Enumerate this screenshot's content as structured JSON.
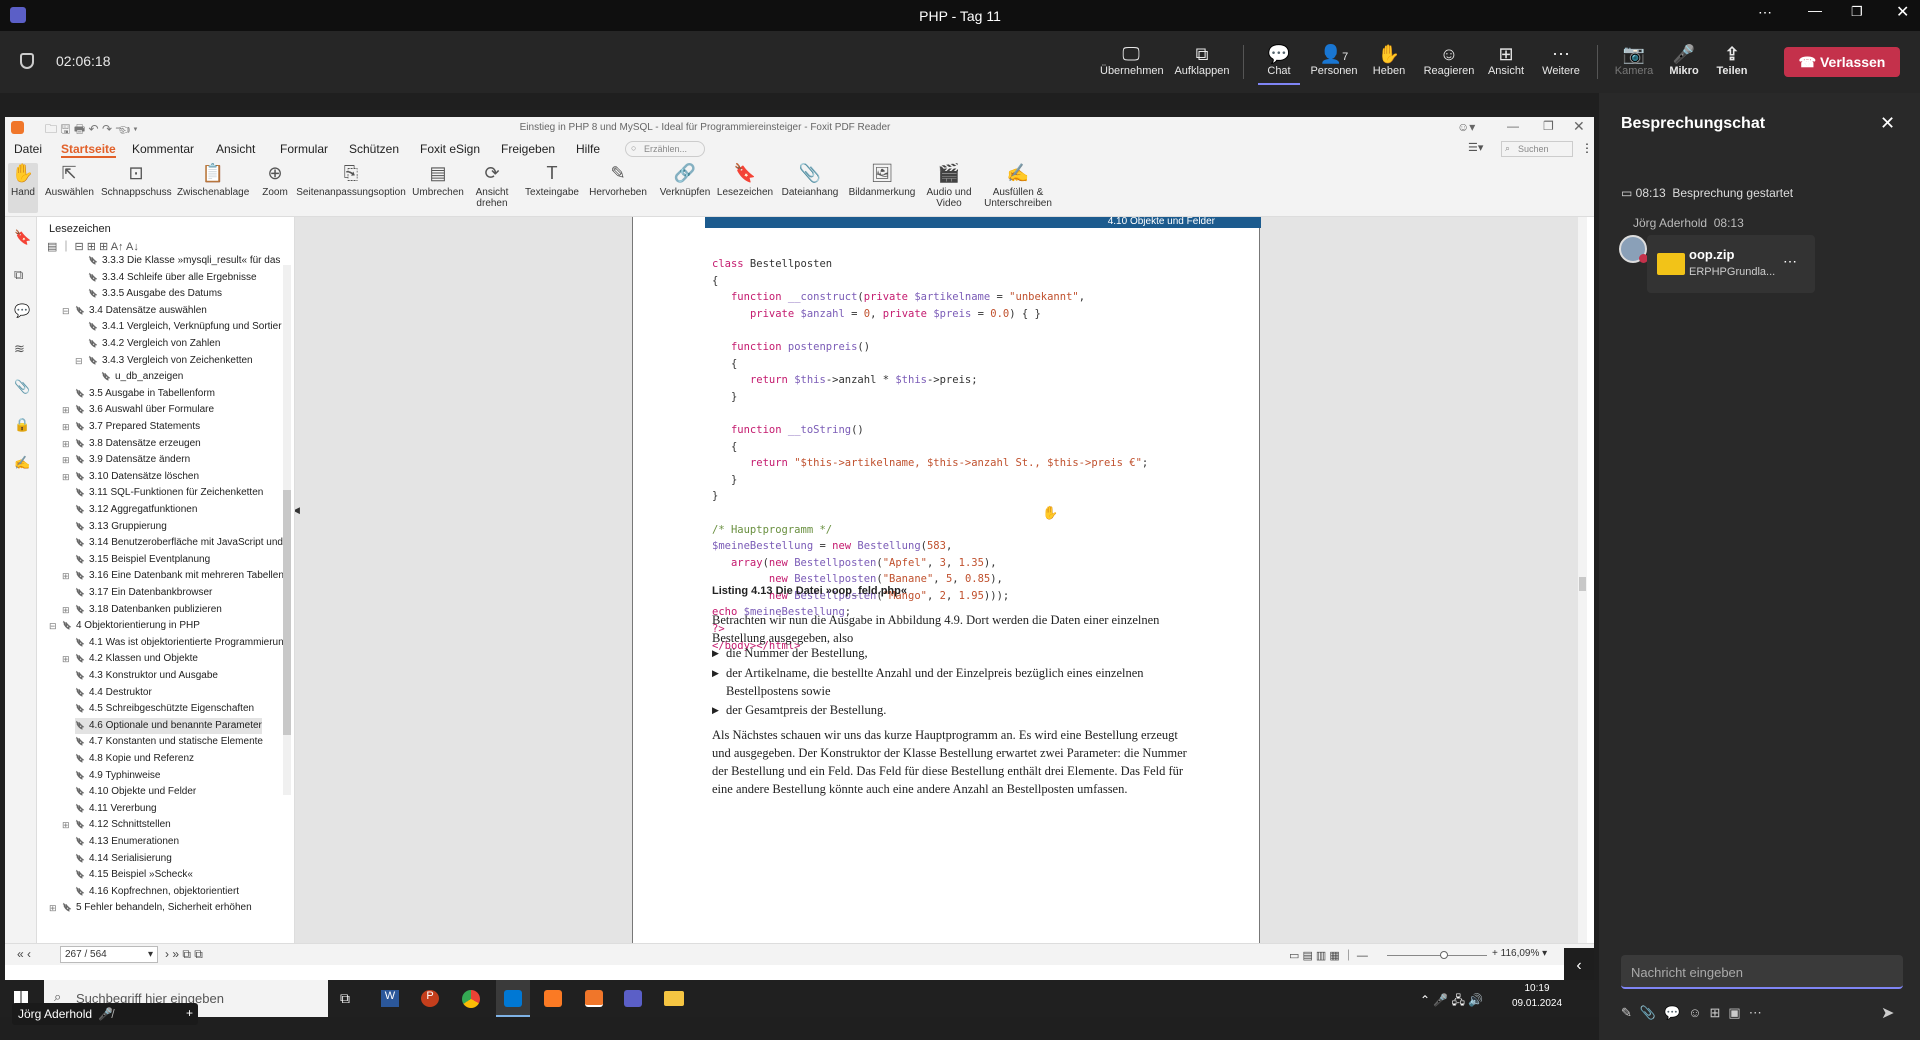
{
  "window_title": "PHP - Tag 11",
  "meeting": {
    "timer": "02:06:18",
    "buttons": [
      "Übernehmen",
      "Aufklappen",
      "Chat",
      "Personen",
      "Heben",
      "Reagieren",
      "Ansicht",
      "Weitere",
      "Kamera",
      "Mikro",
      "Teilen"
    ],
    "people_count": "7",
    "leave_label": "Verlassen"
  },
  "pdf": {
    "title": "Einstieg in PHP 8 und MySQL - Ideal für Programmiereinsteiger - Foxit PDF Reader",
    "menu": [
      "Datei",
      "Startseite",
      "Kommentar",
      "Ansicht",
      "Formular",
      "Schützen",
      "Foxit eSign",
      "Freigeben",
      "Hilfe"
    ],
    "tell_placeholder": "Erzählen...",
    "search_placeholder": "Suchen",
    "ribbon": [
      "Hand",
      "Auswählen",
      "Schnappschuss",
      "Zwischenablage",
      "Zoom",
      "Seitenanpassungsoption",
      "Umbrechen",
      "Ansicht drehen",
      "Texteingabe",
      "Hervorheben",
      "Verknüpfen",
      "Lesezeichen",
      "Dateianhang",
      "Bildanmerkung",
      "Audio und Video",
      "Ausfüllen & Unterschreiben"
    ],
    "bookmarks_title": "Lesezeichen",
    "bookmarks": [
      "3.3.3 Die Klasse »mysqli_result« für das E",
      "3.3.4 Schleife über alle Ergebnisse",
      "3.3.5 Ausgabe des Datums",
      "3.4 Datensätze auswählen",
      "3.4.1 Vergleich, Verknüpfung und Sortier",
      "3.4.2 Vergleich von Zahlen",
      "3.4.3 Vergleich von Zeichenketten",
      "u_db_anzeigen",
      "3.5 Ausgabe in Tabellenform",
      "3.6 Auswahl über Formulare",
      "3.7 Prepared Statements",
      "3.8 Datensätze erzeugen",
      "3.9 Datensätze ändern",
      "3.10 Datensätze löschen",
      "3.11 SQL-Funktionen für Zeichenketten",
      "3.12 Aggregatfunktionen",
      "3.13 Gruppierung",
      "3.14 Benutzeroberfläche mit JavaScript und",
      "3.15 Beispiel Eventplanung",
      "3.16 Eine Datenbank mit mehreren Tabellen",
      "3.17 Ein Datenbankbrowser",
      "3.18 Datenbanken publizieren",
      "4 Objektorientierung in PHP",
      "4.1 Was ist objektorientierte Programmierun",
      "4.2 Klassen und Objekte",
      "4.3 Konstruktor und Ausgabe",
      "4.4 Destruktor",
      "4.5 Schreibgeschützte Eigenschaften",
      "4.6 Optionale und benannte Parameter",
      "4.7 Konstanten und statische Elemente",
      "4.8 Kopie und Referenz",
      "4.9 Typhinweise",
      "4.10 Objekte und Felder",
      "4.11 Vererbung",
      "4.12 Schnittstellen",
      "4.13 Enumerationen",
      "4.14 Serialisierung",
      "4.15 Beispiel »Scheck«",
      "4.16 Kopfrechnen, objektorientiert",
      "5 Fehler behandeln, Sicherheit erhöhen"
    ],
    "header_band": "4.10   Objekte und Felder",
    "listing_caption": "Listing 4.13  Die Datei »oop_feld.php«",
    "para1": "Betrachten wir nun die Ausgabe in Abbildung 4.9. Dort werden die Daten einer einzelnen Bestellung ausgegeben, also",
    "bullets": [
      "die Nummer der Bestellung,",
      "der Artikelname, die bestellte Anzahl und der Einzelpreis bezüglich eines einzelnen Bestellpostens sowie",
      "der Gesamtpreis der Bestellung."
    ],
    "para2": "Als Nächstes schauen wir uns das kurze Hauptprogramm an. Es wird eine Bestellung erzeugt und ausgegeben. Der Konstruktor der Klasse Bestellung erwartet zwei Parameter: die Nummer der Bestellung und ein Feld. Das Feld für diese Bestellung enthält drei Elemente. Das Feld für eine andere Bestellung könnte auch eine andere Anzahl an Bestellposten umfassen.",
    "page_indicator": "267 / 564",
    "zoom": "116,09%"
  },
  "taskbar": {
    "search_placeholder": "Suchbegriff hier eingeben",
    "time": "10:19",
    "date": "09.01.2024",
    "presenter": "Jörg Aderhold"
  },
  "chat": {
    "title": "Besprechungschat",
    "meeting_time": "08:13",
    "meeting_event": "Besprechung gestartet",
    "sender": "Jörg Aderhold",
    "sender_time": "08:13",
    "file_name": "oop.zip",
    "file_sub": "ERPHPGrundla...",
    "input_placeholder": "Nachricht eingeben"
  }
}
